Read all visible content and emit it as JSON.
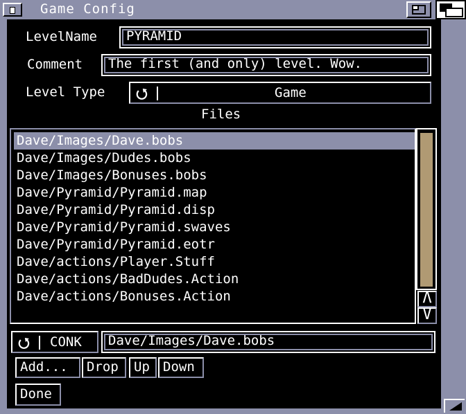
{
  "window": {
    "title": "Game Config"
  },
  "form": {
    "level_name_label": "LevelName",
    "level_name_value": "PYRAMID",
    "comment_label": "Comment",
    "comment_value": "The first (and only) level. Wow.",
    "level_type_label": "Level Type",
    "level_type_value": "Game"
  },
  "files": {
    "heading": "Files",
    "items": [
      "Dave/Images/Dave.bobs",
      "Dave/Images/Dudes.bobs",
      "Dave/Images/Bonuses.bobs",
      "Dave/Pyramid/Pyramid.map",
      "Dave/Pyramid/Pyramid.disp",
      "Dave/Pyramid/Pyramid.swaves",
      "Dave/Pyramid/Pyramid.eotr",
      "Dave/actions/Player.Stuff",
      "Dave/actions/BadDudes.Action",
      "Dave/actions/Bonuses.Action"
    ],
    "selected_index": 0,
    "type_cycle_value": "CONK",
    "selected_path": "Dave/Images/Dave.bobs",
    "scroll_up_glyph": "Λ",
    "scroll_down_glyph": "V"
  },
  "buttons": {
    "add": "Add...",
    "drop": "Drop",
    "up": "Up",
    "down": "Down",
    "done": "Done"
  },
  "icons": {
    "close": "close-gadget",
    "zoom": "zoom-gadget",
    "depth": "depth-gadget",
    "cycle": "cycle-icon",
    "resize": "resize-gadget"
  },
  "colors": {
    "frame": "#8c8faa",
    "background": "#000000",
    "text": "#ffffff",
    "scroll_knob": "#b09a73"
  }
}
